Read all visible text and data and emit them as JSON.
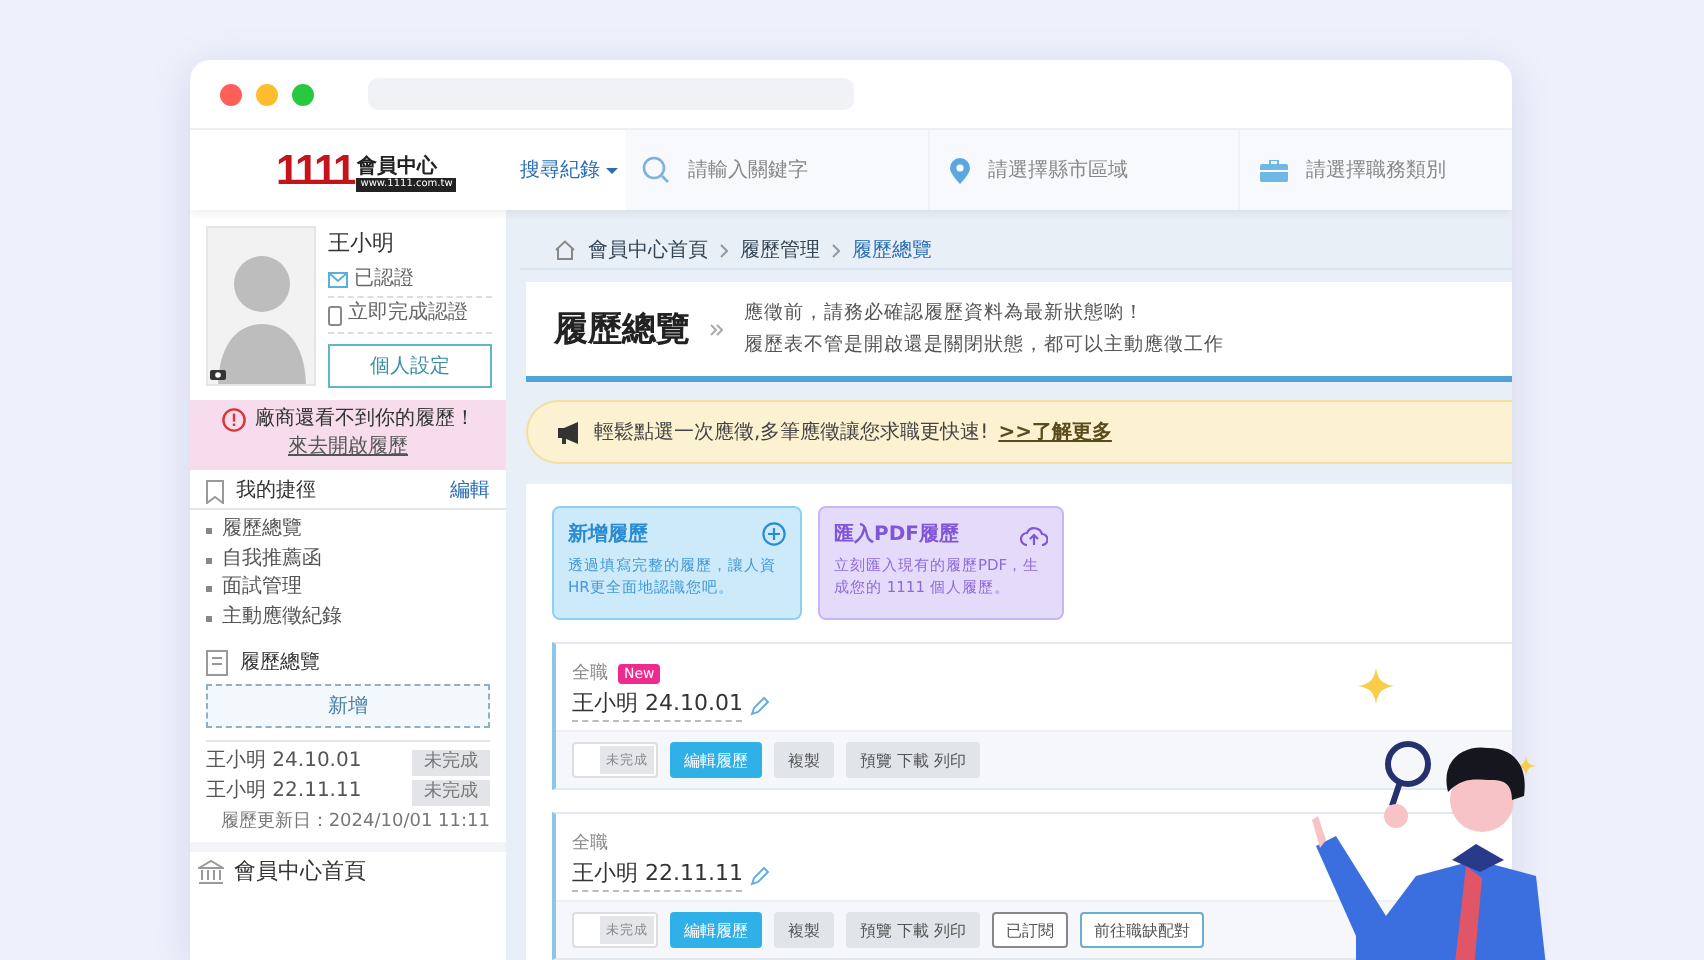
{
  "header": {
    "logo": {
      "number": "1111",
      "title": "會員中心",
      "url": "www.1111.com.tw"
    },
    "history_menu": "搜尋紀錄",
    "search": [
      {
        "kind": "keyword",
        "placeholder": "請輸入關鍵字"
      },
      {
        "kind": "location",
        "placeholder": "請選擇縣市區域"
      },
      {
        "kind": "category",
        "placeholder": "請選擇職務類別"
      }
    ]
  },
  "sidebar": {
    "profile": {
      "name": "王小明",
      "verifications": [
        {
          "kind": "email",
          "label": "已認證"
        },
        {
          "kind": "phone",
          "label": "立即完成認證"
        }
      ],
      "settings_button": "個人設定"
    },
    "alert": {
      "message": "廠商還看不到你的履歷！",
      "link": "來去開啟履歷"
    },
    "shortcuts": {
      "title": "我的捷徑",
      "edit": "編輯",
      "items": [
        "履歷總覽",
        "自我推薦函",
        "面試管理",
        "主動應徵紀錄"
      ]
    },
    "resume_overview": {
      "title": "履歷總覽",
      "add_button": "新增",
      "resumes": [
        {
          "name": "王小明 24.10.01",
          "status": "未完成"
        },
        {
          "name": "王小明 22.11.11",
          "status": "未完成"
        }
      ],
      "updated": "履歷更新日：2024/10/01 11:11"
    },
    "home_link": "會員中心首頁"
  },
  "breadcrumb": [
    "會員中心首頁",
    "履歷管理",
    "履歷總覽"
  ],
  "page_header": {
    "title": "履歷總覽",
    "notes": [
      "應徵前，請務必確認履歷資料為最新狀態喲！",
      "履歷表不管是開啟還是關閉狀態，都可以主動應徵工作"
    ]
  },
  "banner": {
    "text": "輕鬆點選一次應徵,多筆應徵讓您求職更快速!",
    "link": ">>了解更多"
  },
  "create_cards": [
    {
      "kind": "new",
      "title": "新增履歷",
      "description": "透過填寫完整的履歷，讓人資HR更全面地認識您吧。"
    },
    {
      "kind": "pdf",
      "title": "匯入PDF履歷",
      "description": "立刻匯入現有的履歷PDF，生成您的 1111 個人履歷。"
    }
  ],
  "resumes": [
    {
      "type": "全職",
      "badge": "New",
      "title": "王小明 24.10.01",
      "toggle": {
        "on": false,
        "label": "未完成"
      },
      "actions": [
        {
          "kind": "primary",
          "label": "編輯履歷"
        },
        {
          "kind": "grey",
          "label": "複製"
        },
        {
          "kind": "grey",
          "label": "預覽 下載 列印"
        }
      ]
    },
    {
      "type": "全職",
      "title": "王小明 22.11.11",
      "toggle": {
        "on": false,
        "label": "未完成"
      },
      "actions": [
        {
          "kind": "primary",
          "label": "編輯履歷"
        },
        {
          "kind": "grey",
          "label": "複製"
        },
        {
          "kind": "grey",
          "label": "預覽 下載 列印"
        },
        {
          "kind": "outline",
          "label": "已訂閱"
        },
        {
          "kind": "outline-blue",
          "label": "前往職缺配對"
        }
      ]
    }
  ]
}
